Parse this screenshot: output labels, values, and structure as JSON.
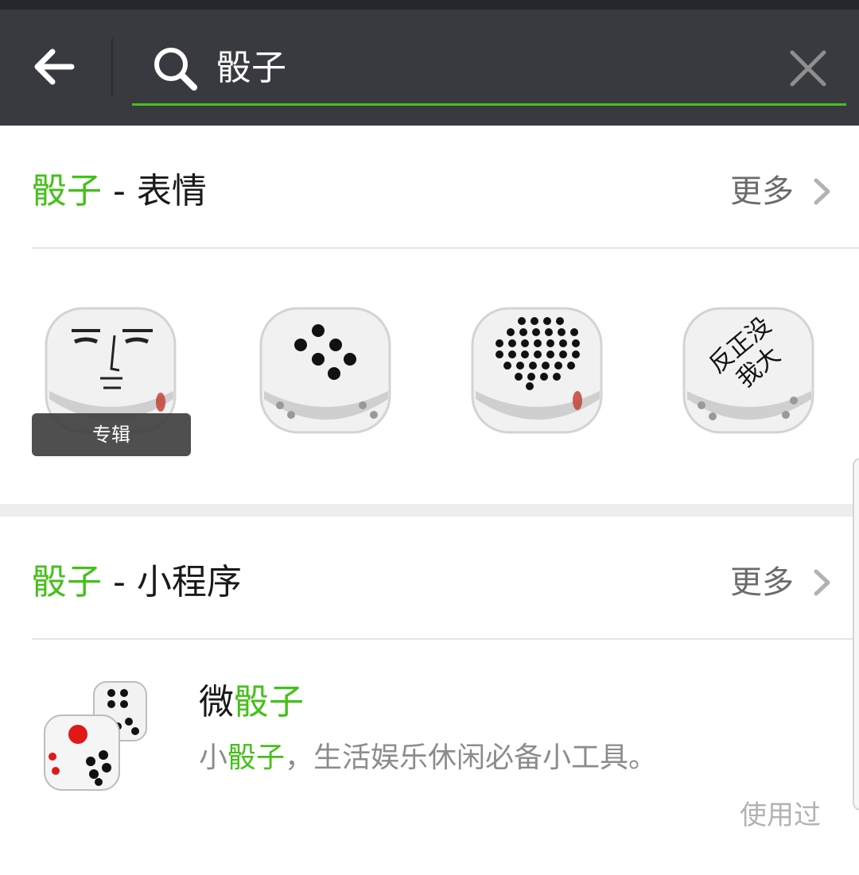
{
  "search": {
    "query": "骰子"
  },
  "sections": [
    {
      "keyword": "骰子",
      "separator": " - ",
      "title": "表情",
      "more_label": "更多"
    },
    {
      "keyword": "骰子",
      "separator": " - ",
      "title": "小程序",
      "more_label": "更多"
    }
  ],
  "stickers": {
    "album_tag": "专辑",
    "items": [
      {
        "icon": "dice-face-sticker-icon"
      },
      {
        "icon": "dice-six-dots-sticker-icon"
      },
      {
        "icon": "dice-many-dots-sticker-icon"
      },
      {
        "icon": "dice-text-sticker-icon",
        "text_line1": "反正没",
        "text_line2": "我大"
      }
    ]
  },
  "mini_program": {
    "name_prefix": "微",
    "name_highlight": "骰子",
    "desc_prefix": "小",
    "desc_highlight": "骰子",
    "desc_rest": "，生活娱乐休闲必备小工具。",
    "badge": "使用过",
    "icon": "dice-pair-app-icon"
  },
  "colors": {
    "header_bg": "#393a3f",
    "accent": "#45c01a",
    "text": "#191919",
    "secondary_text": "#8c8c8c"
  }
}
